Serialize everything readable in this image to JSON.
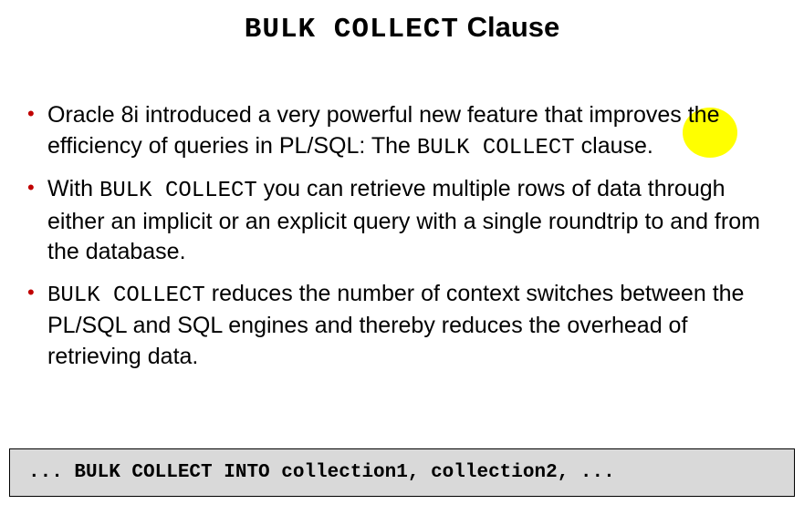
{
  "title": {
    "mono": "BULK COLLECT",
    "rest": " Clause"
  },
  "bullets": [
    {
      "pre": "Oracle 8i introduced a very powerful new feature that improves ",
      "hl": "the",
      "post1": " efficiency of queries in PL/SQL: The ",
      "code1": "BULK COLLECT",
      "post2": " clause."
    },
    {
      "pre": "With ",
      "code1": "BULK COLLECT",
      "post1": " you can retrieve multiple rows of data through either an implicit or an explicit query with a single roundtrip to and from the database."
    },
    {
      "code1": "BULK COLLECT",
      "post1": " reduces the number of context switches between the PL/SQL and SQL engines and thereby reduces the overhead of retrieving data."
    }
  ],
  "codebox": "... BULK COLLECT INTO collection1, collection2, ..."
}
